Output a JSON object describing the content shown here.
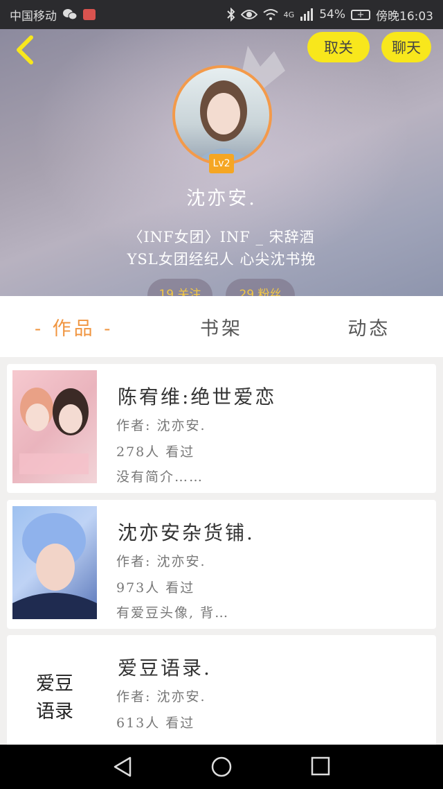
{
  "status_bar": {
    "carrier": "中国移动",
    "network": "4G",
    "battery": "54%",
    "time": "傍晚16:03"
  },
  "header": {
    "follow_label": "取关",
    "chat_label": "聊天",
    "level": "Lv2",
    "nickname": "沈亦安.",
    "bio_line1": "〈INF女团〉INF _ 宋辞酒",
    "bio_line2": "YSL女团经纪人 心尖沈书挽",
    "following": "19 关注",
    "fans": "29 粉丝"
  },
  "tabs": [
    {
      "label": "- 作品 -",
      "active": true
    },
    {
      "label": "书架",
      "active": false
    },
    {
      "label": "动态",
      "active": false
    }
  ],
  "books": [
    {
      "title": "陈宥维:绝世爱恋",
      "author": "作者: 沈亦安.",
      "views": "278人 看过",
      "desc": "没有简介……"
    },
    {
      "title": "沈亦安杂货铺.",
      "author": "作者: 沈亦安.",
      "views": "973人 看过",
      "desc": "有爱豆头像, 背…"
    },
    {
      "title": "爱豆语录.",
      "author": "作者: 沈亦安.",
      "views": "613人 看过",
      "desc": "",
      "cover_text": [
        "爱豆",
        "语录"
      ]
    }
  ],
  "colors": {
    "accent_yellow": "#f8e71c",
    "active_tab": "#f09540",
    "avatar_ring": "#f39a4a",
    "level_badge": "#f5a623"
  }
}
